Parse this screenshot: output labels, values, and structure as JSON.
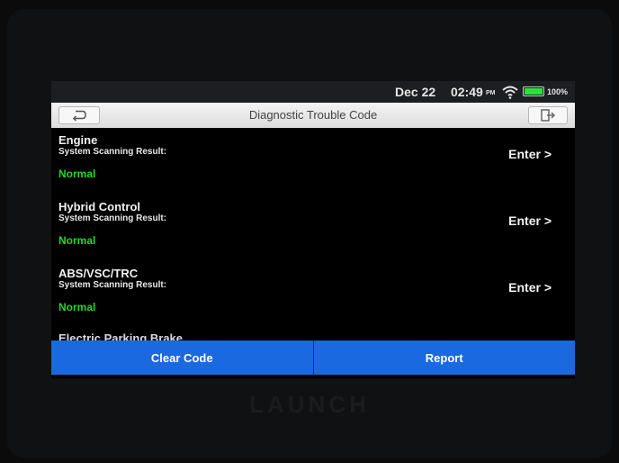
{
  "status": {
    "date": "Dec 22",
    "time": "02:49",
    "ampm": "PM",
    "battery": "100%",
    "battery_level": 1.0,
    "battery_color": "#29e33a"
  },
  "header": {
    "title": "Diagnostic Trouble Code",
    "back_icon": "back-arrow-icon",
    "exit_icon": "exit-icon"
  },
  "systems": [
    {
      "name": "Engine",
      "label": "System Scanning Result:",
      "status": "Normal",
      "action": "Enter >"
    },
    {
      "name": "Hybrid Control",
      "label": "System Scanning Result:",
      "status": "Normal",
      "action": "Enter >"
    },
    {
      "name": "ABS/VSC/TRC",
      "label": "System Scanning Result:",
      "status": "Normal",
      "action": "Enter >"
    },
    {
      "name": "Electric Parking Brake"
    }
  ],
  "footer": {
    "clear_label": "Clear Code",
    "report_label": "Report"
  },
  "device": {
    "brand": "LAUNCH"
  },
  "colors": {
    "accent": "#1b69e0",
    "normal": "#25d52c"
  }
}
